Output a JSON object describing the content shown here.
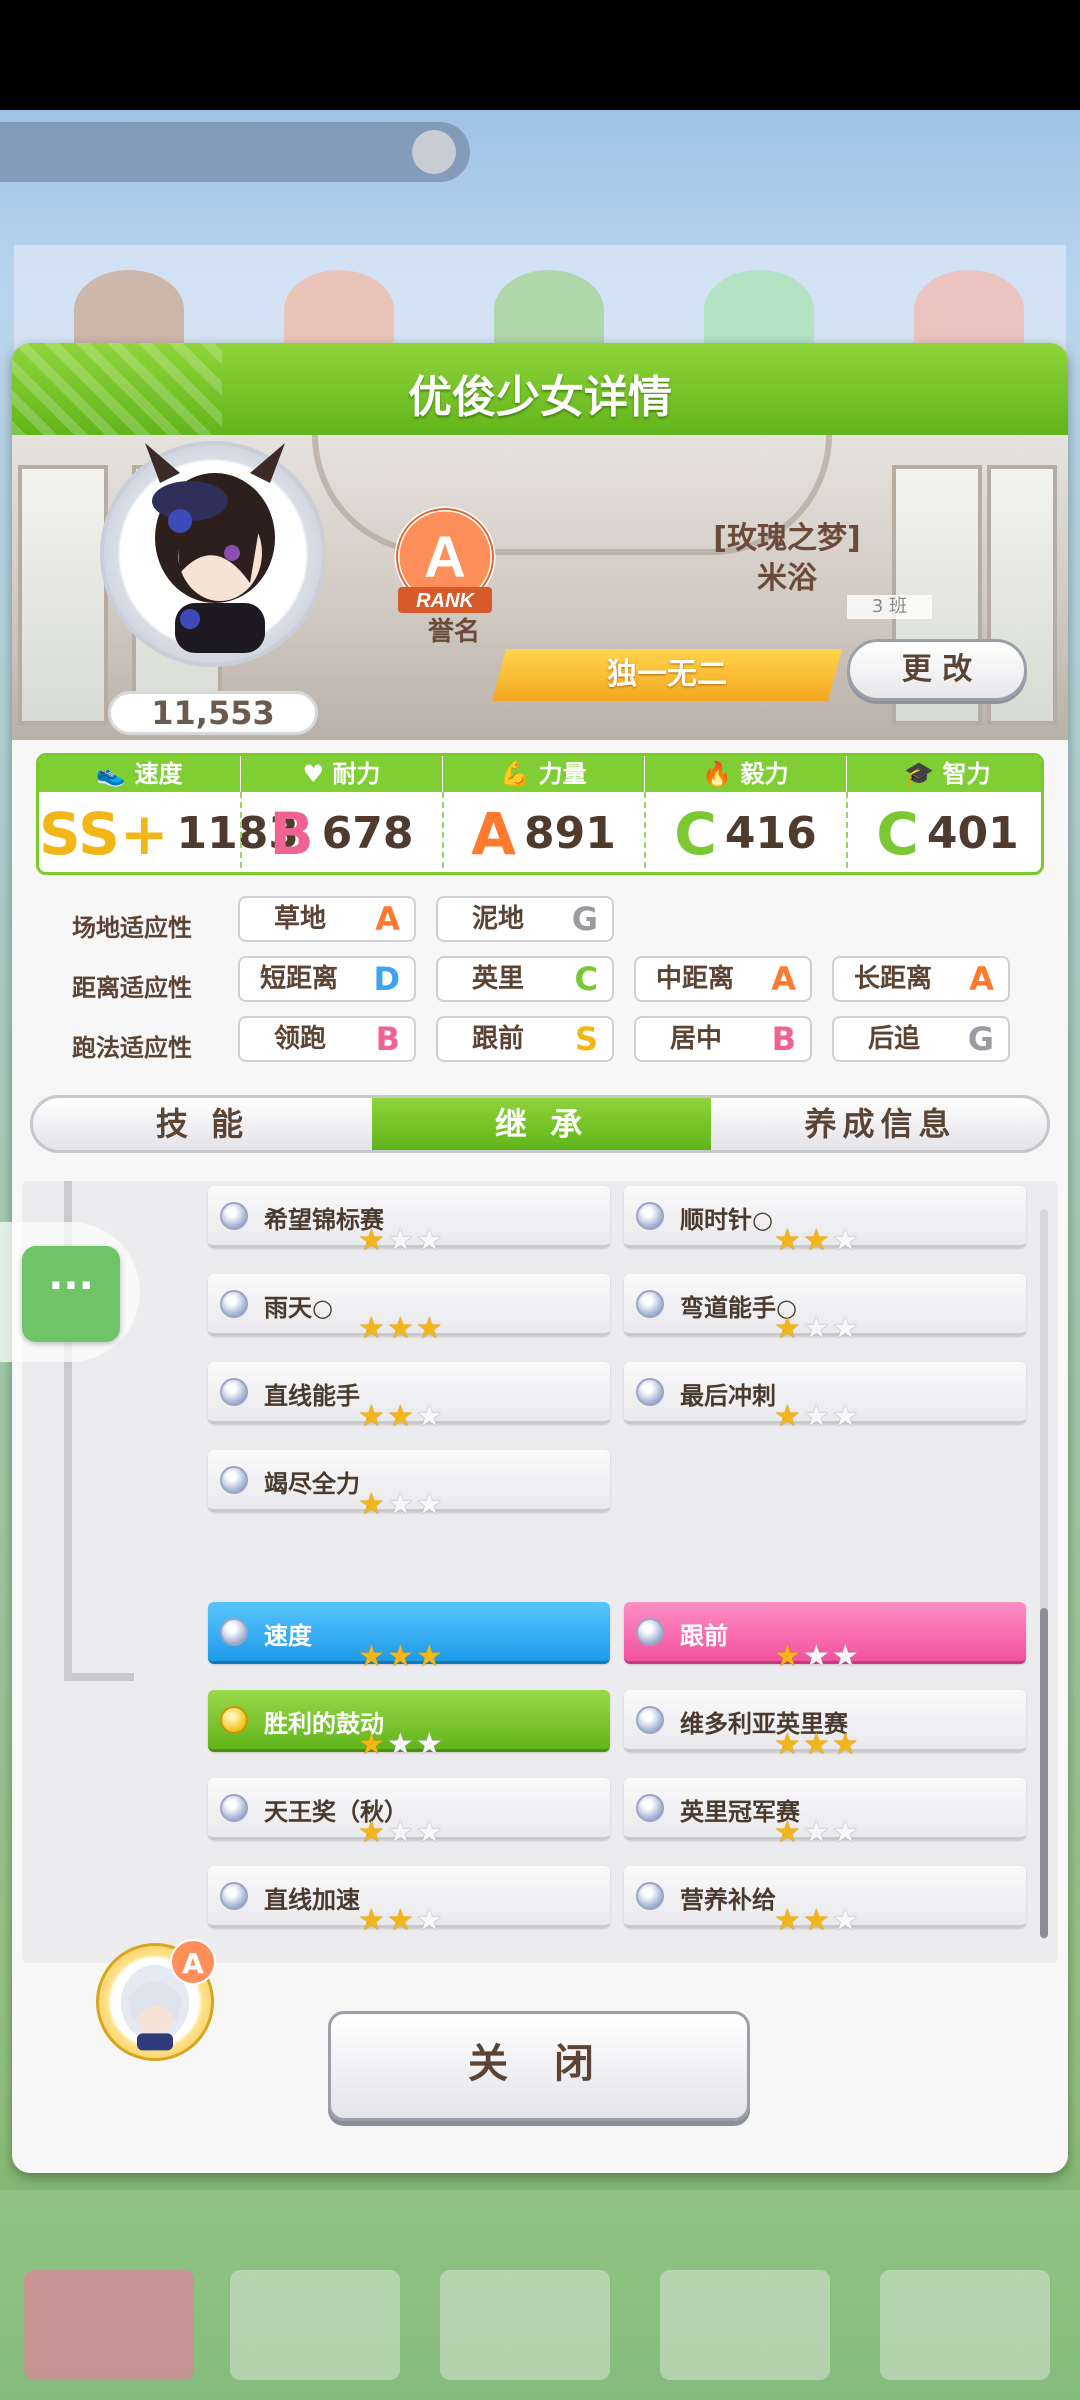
{
  "dialog": {
    "title": "优俊少女详情"
  },
  "character": {
    "score": "11,553",
    "rank_letter": "A",
    "rank_word": "RANK",
    "rank_label": "誉名",
    "epithet": "[玫瑰之梦]",
    "name": "米浴",
    "class_tag": "3 班",
    "unique_title": "独一无二",
    "change_button": "更 改"
  },
  "stats": [
    {
      "label": "速度",
      "grade": "SS+",
      "value": "1183",
      "color": "#f2b619"
    },
    {
      "label": "耐力",
      "grade": "B",
      "value": "678",
      "color": "#f06292"
    },
    {
      "label": "力量",
      "grade": "A",
      "value": "891",
      "color": "#ff7a2f"
    },
    {
      "label": "毅力",
      "grade": "C",
      "value": "416",
      "color": "#7cc832"
    },
    {
      "label": "智力",
      "grade": "C",
      "value": "401",
      "color": "#7cc832"
    }
  ],
  "aptitude": {
    "track": {
      "label": "场地适应性",
      "items": [
        {
          "name": "草地",
          "grade": "A"
        },
        {
          "name": "泥地",
          "grade": "G"
        }
      ]
    },
    "distance": {
      "label": "距离适应性",
      "items": [
        {
          "name": "短距离",
          "grade": "D"
        },
        {
          "name": "英里",
          "grade": "C"
        },
        {
          "name": "中距离",
          "grade": "A"
        },
        {
          "name": "长距离",
          "grade": "A"
        }
      ]
    },
    "style": {
      "label": "跑法适应性",
      "items": [
        {
          "name": "领跑",
          "grade": "B"
        },
        {
          "name": "跟前",
          "grade": "S"
        },
        {
          "name": "居中",
          "grade": "B"
        },
        {
          "name": "后追",
          "grade": "G"
        }
      ]
    }
  },
  "tabs": [
    "技 能",
    "继 承",
    "养成信息"
  ],
  "active_tab": 1,
  "inherit_top": [
    {
      "name": "希望锦标赛",
      "stars": 1
    },
    {
      "name": "顺时针○",
      "stars": 2
    },
    {
      "name": "雨天○",
      "stars": 3
    },
    {
      "name": "弯道能手○",
      "stars": 1
    },
    {
      "name": "直线能手",
      "stars": 2
    },
    {
      "name": "最后冲刺",
      "stars": 1
    },
    {
      "name": "竭尽全力",
      "stars": 1
    }
  ],
  "parent": {
    "rank_letter": "A"
  },
  "inherit_parent": [
    {
      "name": "速度",
      "stars": 3,
      "style": "blue"
    },
    {
      "name": "跟前",
      "stars": 1,
      "style": "pink"
    },
    {
      "name": "胜利的鼓动",
      "stars": 1,
      "style": "green"
    },
    {
      "name": "维多利亚英里赛",
      "stars": 3,
      "style": "plain"
    },
    {
      "name": "天王奖（秋）",
      "stars": 1,
      "style": "plain"
    },
    {
      "name": "英里冠军赛",
      "stars": 1,
      "style": "plain"
    },
    {
      "name": "直线加速",
      "stars": 2,
      "style": "plain"
    },
    {
      "name": "营养补给",
      "stars": 2,
      "style": "plain"
    }
  ],
  "close_button": "关 闭",
  "float_button": "···",
  "grade_colors": {
    "S": "#f2b619",
    "A": "#ff7a2f",
    "B": "#f06292",
    "C": "#7cc832",
    "D": "#3fa3f0",
    "G": "#9a9aa2"
  }
}
